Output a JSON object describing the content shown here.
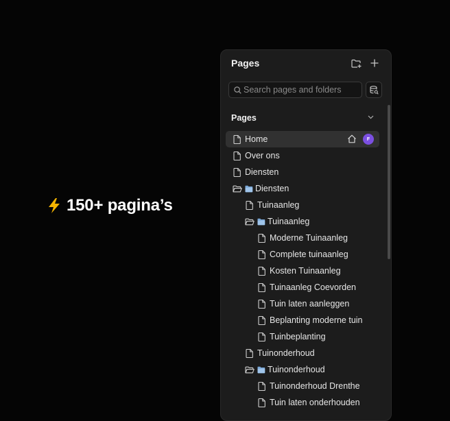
{
  "headline": {
    "text": "150+ pagina’s",
    "icon": "lightning-bolt-icon"
  },
  "panel": {
    "title": "Pages",
    "search": {
      "placeholder": "Search pages and folders",
      "value": ""
    },
    "section": {
      "label": "Pages"
    },
    "tree": [
      {
        "label": "Home",
        "type": "page",
        "depth": 0,
        "selected": true,
        "home": true,
        "avatar": "F"
      },
      {
        "label": "Over ons",
        "type": "page",
        "depth": 0
      },
      {
        "label": "Diensten",
        "type": "page",
        "depth": 0
      },
      {
        "label": "Diensten",
        "type": "folder",
        "depth": 0
      },
      {
        "label": "Tuinaanleg",
        "type": "page",
        "depth": 1
      },
      {
        "label": "Tuinaanleg",
        "type": "folder",
        "depth": 1
      },
      {
        "label": "Moderne Tuinaanleg",
        "type": "page",
        "depth": 2
      },
      {
        "label": "Complete tuinaanleg",
        "type": "page",
        "depth": 2
      },
      {
        "label": "Kosten Tuinaanleg",
        "type": "page",
        "depth": 2
      },
      {
        "label": "Tuinaanleg Coevorden",
        "type": "page",
        "depth": 2
      },
      {
        "label": "Tuin laten aanleggen",
        "type": "page",
        "depth": 2
      },
      {
        "label": "Beplanting moderne tuin",
        "type": "page",
        "depth": 2
      },
      {
        "label": "Tuinbeplanting",
        "type": "page",
        "depth": 2
      },
      {
        "label": "Tuinonderhoud",
        "type": "page",
        "depth": 1
      },
      {
        "label": "Tuinonderhoud",
        "type": "folder",
        "depth": 1
      },
      {
        "label": "Tuinonderhoud Drenthe",
        "type": "page",
        "depth": 2
      },
      {
        "label": "Tuin laten onderhouden",
        "type": "page",
        "depth": 2
      }
    ]
  },
  "colors": {
    "accent_avatar": "#7b4fe0",
    "bolt": "#f5b400",
    "panel_bg": "#1c1c1c"
  }
}
